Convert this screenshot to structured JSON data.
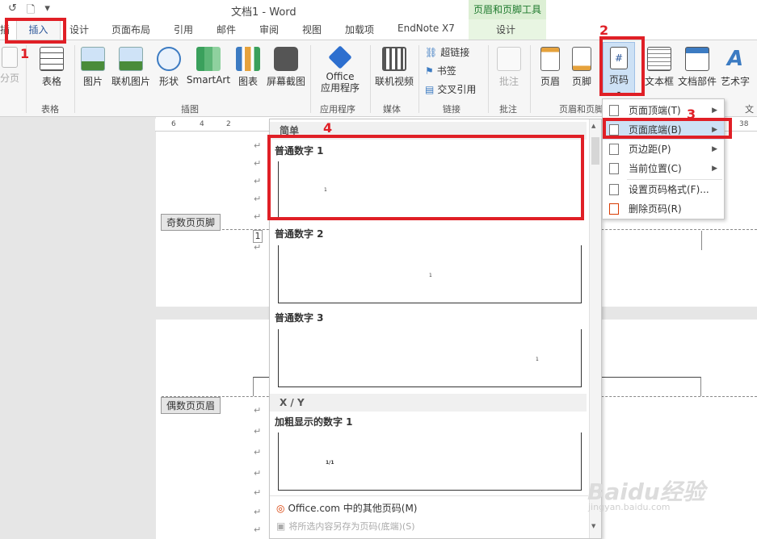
{
  "qat": {
    "undo": "↺",
    "newdoc": "🗋",
    "more": "▾"
  },
  "title": "文档1 - Word",
  "ctx": {
    "title": "页眉和页脚工具",
    "tab": "设计"
  },
  "tabs": {
    "partial": "插",
    "insert": "插入",
    "design": "设计",
    "layout": "页面布局",
    "references": "引用",
    "mailings": "邮件",
    "review": "审阅",
    "view": "视图",
    "addins": "加载项",
    "endnote": "EndNote X7"
  },
  "ribbon": {
    "page_break": "分页",
    "table": "表格",
    "picture": "图片",
    "online_picture": "联机图片",
    "shapes": "形状",
    "smartart": "SmartArt",
    "chart": "图表",
    "screenshot": "屏幕截图",
    "office_apps_1": "Office",
    "office_apps_2": "应用程序",
    "online_video": "联机视频",
    "hyperlink": "超链接",
    "bookmark": "书签",
    "cross_ref": "交叉引用",
    "comment": "批注",
    "header": "页眉",
    "footer": "页脚",
    "page_number": "页码",
    "textbox": "文本框",
    "quickparts": "文档部件",
    "wordart": "艺术字",
    "text_group_partial": "文",
    "groups": {
      "tables": "表格",
      "illustrations": "插图",
      "apps": "应用程序",
      "media": "媒体",
      "links": "链接",
      "comments": "批注",
      "header_footer": "页眉和页脚"
    }
  },
  "annotations": {
    "n1": "1",
    "n2": "2",
    "n3": "3",
    "n4": "4"
  },
  "doc": {
    "odd_footer": "奇数页页脚",
    "even_header": "偶数页页眉",
    "page_num": "1",
    "para": "↵"
  },
  "ruler": {
    "ticks": [
      "6",
      "4",
      "2"
    ],
    "right_tick": "38"
  },
  "gallery": {
    "section1": "简单",
    "item1": "普通数字 1",
    "item2": "普通数字 2",
    "item3": "普通数字 3",
    "section2": "X / Y",
    "item4": "加粗显示的数字 1",
    "preview_1": "1",
    "preview_4": "1/1",
    "more": "Office.com 中的其他页码(M)",
    "save": "将所选内容另存为页码(底端)(S)"
  },
  "submenu": {
    "top": "页面顶端(T)",
    "bottom": "页面底端(B)",
    "margin": "页边距(P)",
    "current": "当前位置(C)",
    "format": "设置页码格式(F)...",
    "remove": "删除页码(R)"
  },
  "watermark": {
    "brand": "Baidu经验",
    "url": "jingyan.baidu.com"
  },
  "colors": {
    "accent": "#2b579a",
    "annotation": "#e01f26",
    "context": "#dcefd4"
  }
}
